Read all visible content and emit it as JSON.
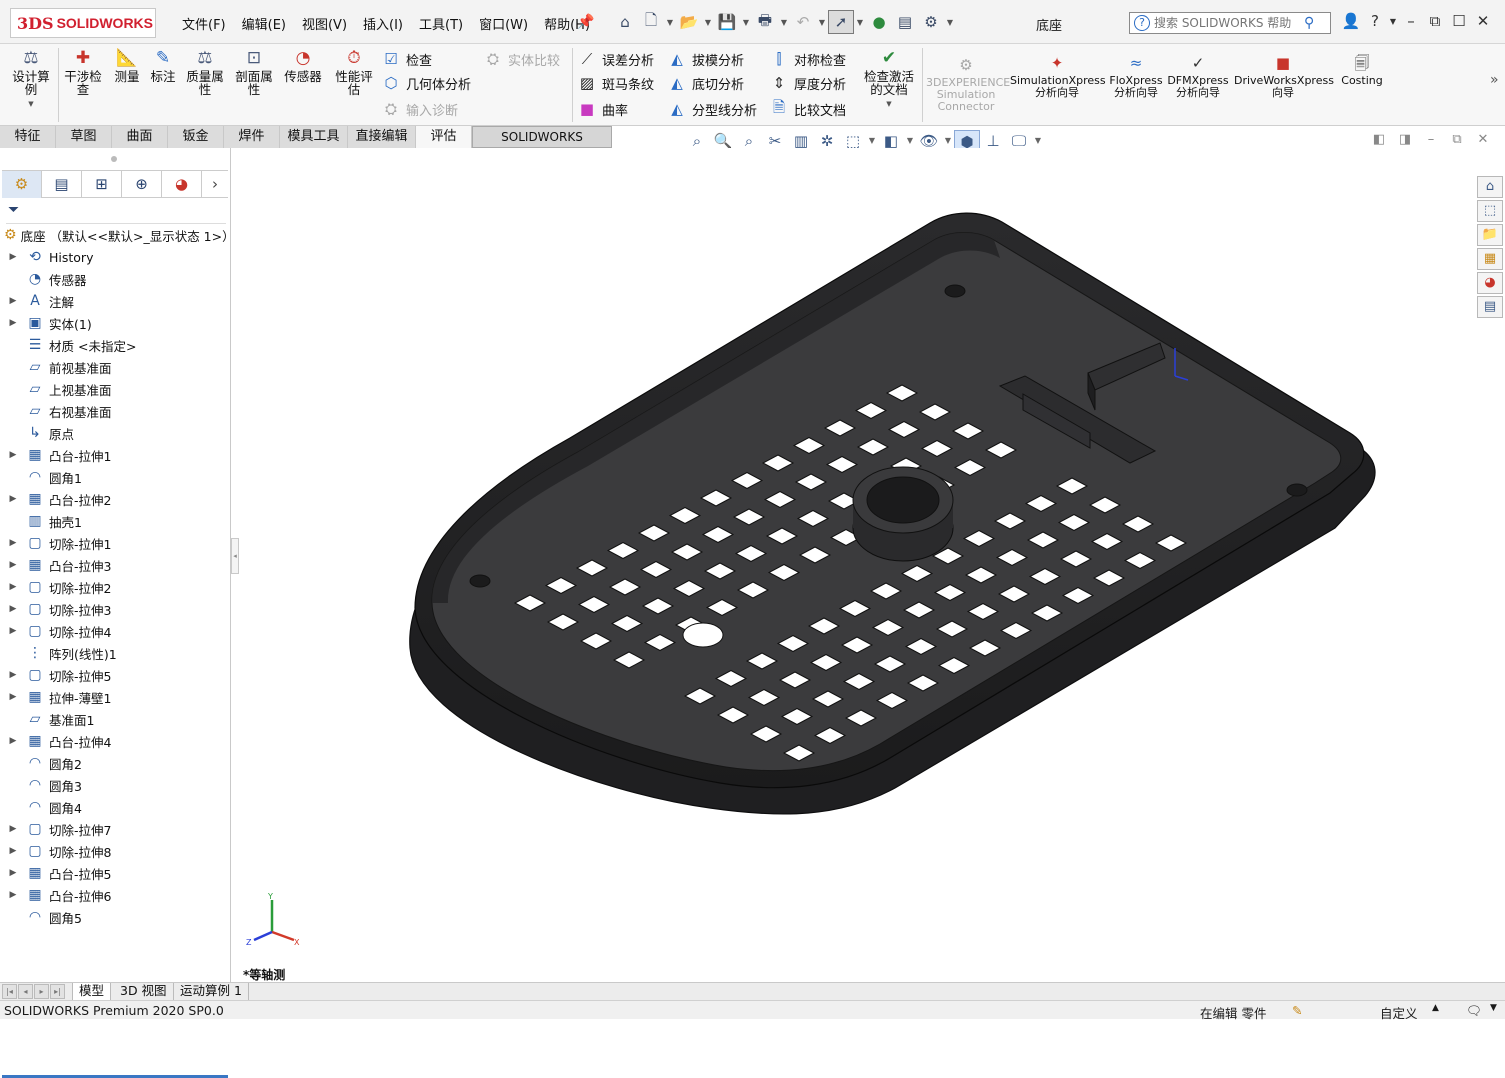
{
  "app": {
    "brand_mark": "3DS",
    "brand_name": "SOLIDWORKS"
  },
  "menu": [
    "文件(F)",
    "编辑(E)",
    "视图(V)",
    "插入(I)",
    "工具(T)",
    "窗口(W)",
    "帮助(H)"
  ],
  "document_title": "底座",
  "search": {
    "placeholder": "搜索 SOLIDWORKS 帮助"
  },
  "ribbon": {
    "design_check": "设计算例",
    "interference": "干涉检查",
    "measure": "测量",
    "markup": "标注",
    "mass_properties": "质量属性",
    "section_properties": "剖面属性",
    "sensor": "传感器",
    "performance_eval": "性能评估",
    "check": "检查",
    "geometry_analysis": "几何体分析",
    "import_diagnostics": "输入诊断",
    "compare_bodies": "实体比较",
    "deviation_analysis": "误差分析",
    "zebra_stripes": "斑马条纹",
    "curvature": "曲率",
    "draft_analysis": "拔模分析",
    "undercut_analysis": "底切分析",
    "parting_line_analysis": "分型线分析",
    "symmetry_check": "对称检查",
    "thickness_analysis": "厚度分析",
    "compare_documents": "比较文档",
    "check_active_doc": "检查激活的文档",
    "experience_connector": "3DEXPERIENCE Simulation Connector",
    "simulation_xpress": "SimulationXpress 分析向导",
    "flo_xpress": "FloXpress 分析向导",
    "dfm_xpress": "DFMXpress 分析向导",
    "driveworks_xpress": "DriveWorksXpress 向导",
    "costing": "Costing"
  },
  "tabs": [
    "特征",
    "草图",
    "曲面",
    "钣金",
    "焊件",
    "模具工具",
    "直接编辑",
    "评估",
    "SOLIDWORKS Visualize"
  ],
  "active_tab": "评估",
  "feature_tree": {
    "root": "底座 （默认<<默认>_显示状态 1>）",
    "items": [
      {
        "label": "History",
        "expandable": true,
        "icon": "history-icon"
      },
      {
        "label": "传感器",
        "expandable": false,
        "icon": "sensor-icon"
      },
      {
        "label": "注解",
        "expandable": true,
        "icon": "annotation-icon"
      },
      {
        "label": "实体(1)",
        "expandable": true,
        "icon": "solid-body-icon"
      },
      {
        "label": "材质 <未指定>",
        "expandable": false,
        "icon": "material-icon"
      },
      {
        "label": "前视基准面",
        "expandable": false,
        "icon": "plane-icon"
      },
      {
        "label": "上视基准面",
        "expandable": false,
        "icon": "plane-icon"
      },
      {
        "label": "右视基准面",
        "expandable": false,
        "icon": "plane-icon"
      },
      {
        "label": "原点",
        "expandable": false,
        "icon": "origin-icon"
      },
      {
        "label": "凸台-拉伸1",
        "expandable": true,
        "icon": "boss-extrude-icon"
      },
      {
        "label": "圆角1",
        "expandable": false,
        "icon": "fillet-icon"
      },
      {
        "label": "凸台-拉伸2",
        "expandable": true,
        "icon": "boss-extrude-icon"
      },
      {
        "label": "抽壳1",
        "expandable": false,
        "icon": "shell-icon"
      },
      {
        "label": "切除-拉伸1",
        "expandable": true,
        "icon": "cut-extrude-icon"
      },
      {
        "label": "凸台-拉伸3",
        "expandable": true,
        "icon": "boss-extrude-icon"
      },
      {
        "label": "切除-拉伸2",
        "expandable": true,
        "icon": "cut-extrude-icon"
      },
      {
        "label": "切除-拉伸3",
        "expandable": true,
        "icon": "cut-extrude-icon"
      },
      {
        "label": "切除-拉伸4",
        "expandable": true,
        "icon": "cut-extrude-icon"
      },
      {
        "label": "阵列(线性)1",
        "expandable": false,
        "icon": "linear-pattern-icon"
      },
      {
        "label": "切除-拉伸5",
        "expandable": true,
        "icon": "cut-extrude-icon"
      },
      {
        "label": "拉伸-薄壁1",
        "expandable": true,
        "icon": "thin-extrude-icon"
      },
      {
        "label": "基准面1",
        "expandable": false,
        "icon": "plane-icon"
      },
      {
        "label": "凸台-拉伸4",
        "expandable": true,
        "icon": "boss-extrude-icon"
      },
      {
        "label": "圆角2",
        "expandable": false,
        "icon": "fillet-icon"
      },
      {
        "label": "圆角3",
        "expandable": false,
        "icon": "fillet-icon"
      },
      {
        "label": "圆角4",
        "expandable": false,
        "icon": "fillet-icon"
      },
      {
        "label": "切除-拉伸7",
        "expandable": true,
        "icon": "cut-extrude-icon"
      },
      {
        "label": "切除-拉伸8",
        "expandable": true,
        "icon": "cut-extrude-icon"
      },
      {
        "label": "凸台-拉伸5",
        "expandable": true,
        "icon": "boss-extrude-icon"
      },
      {
        "label": "凸台-拉伸6",
        "expandable": true,
        "icon": "boss-extrude-icon"
      },
      {
        "label": "圆角5",
        "expandable": false,
        "icon": "fillet-icon"
      }
    ]
  },
  "viewport": {
    "view_name": "*等轴测",
    "triad_axes": [
      "Y",
      "Z",
      "X"
    ],
    "model_color": "#3b3b3d"
  },
  "bottom_tabs": [
    "模型",
    "3D 视图",
    "运动算例 1"
  ],
  "status": {
    "version": "SOLIDWORKS Premium 2020 SP0.0",
    "editing": "在编辑 零件",
    "units": "自定义"
  },
  "colors": {
    "accent": "#3a77c4",
    "brand": "#d1202f"
  }
}
